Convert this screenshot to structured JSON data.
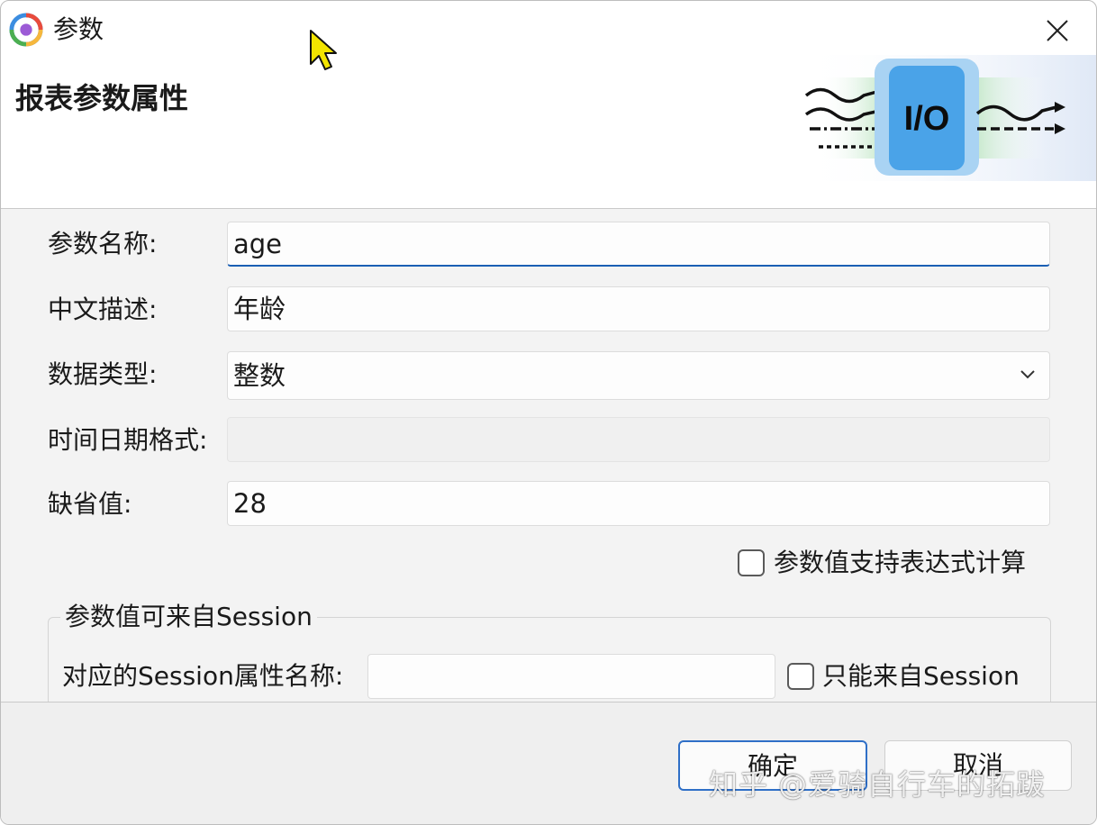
{
  "window": {
    "title": "参数",
    "close_icon": "close-icon",
    "app_icon": "app-logo-icon"
  },
  "header": {
    "title": "报表参数属性",
    "graphic_text": "I/O"
  },
  "form": {
    "param_name": {
      "label": "参数名称:",
      "value": "age"
    },
    "description": {
      "label": "中文描述:",
      "value": "年龄"
    },
    "data_type": {
      "label": "数据类型:",
      "value": "整数"
    },
    "datetime_format": {
      "label": "时间日期格式:",
      "value": ""
    },
    "default_value": {
      "label": "缺省值:",
      "value": "28"
    },
    "expression_checkbox": {
      "label": "参数值支持表达式计算",
      "checked": false
    }
  },
  "session_group": {
    "title": "参数值可来自Session",
    "attr_label": "对应的Session属性名称:",
    "attr_value": "",
    "only_session": {
      "label": "只能来自Session",
      "checked": false
    }
  },
  "buttons": {
    "ok": "确定",
    "cancel": "取消"
  },
  "watermark": "知乎 @爱骑自行车的拓跋",
  "colors": {
    "accent": "#1a5fb4",
    "io_box": "#4aa3e8"
  }
}
